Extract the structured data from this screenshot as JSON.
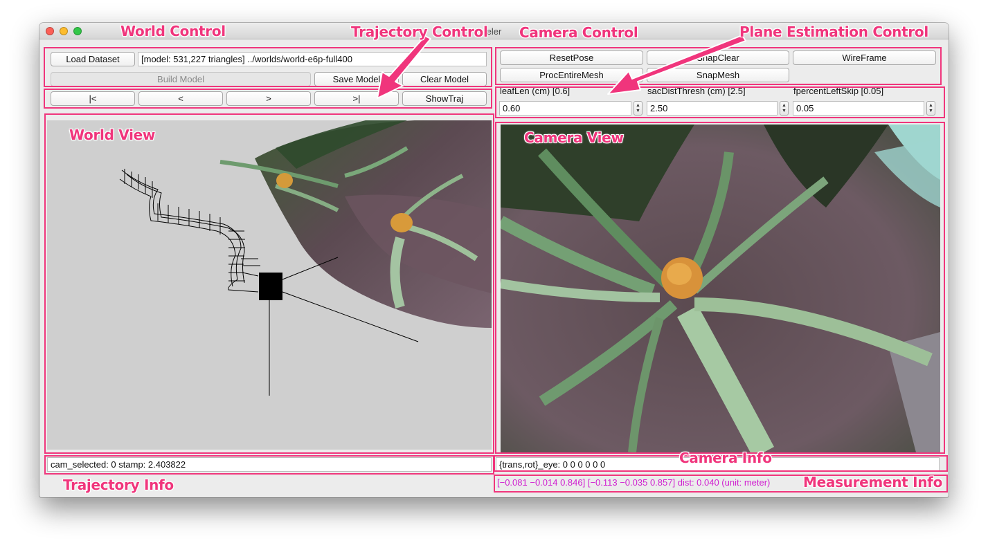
{
  "window": {
    "title": "eler"
  },
  "world_control": {
    "load_label": "Load Dataset",
    "dataset_path": "[model: 531,227 triangles] ../worlds/world-e6p-full400",
    "build_label": "Build Model",
    "save_label": "Save Model",
    "clear_label": "Clear Model"
  },
  "trajectory_control": {
    "first_label": "|<",
    "prev_label": "<",
    "next_label": ">",
    "last_label": ">|",
    "showtraj_label": "ShowTraj"
  },
  "camera_control": {
    "resetpose_label": "ResetPose",
    "snapclear_label": "SnapClear",
    "wireframe_label": "WireFrame",
    "procentire_label": "ProcEntireMesh",
    "snapmesh_label": "SnapMesh"
  },
  "plane_control": {
    "leaflen_label": "leafLen (cm) [0.6]",
    "leaflen_value": "0.60",
    "sacdist_label": "sacDistThresh (cm) [2.5]",
    "sacdist_value": "2.50",
    "fpercent_label": "fpercentLeftSkip [0.05]",
    "fpercent_value": "0.05"
  },
  "trajectory_info": {
    "text": "cam_selected: 0 stamp: 2.403822"
  },
  "camera_info": {
    "text": "{trans,rot}_eye: 0 0 0 0 0 0"
  },
  "measurement_info": {
    "text": "[−0.081 −0.014 0.846] [−0.113 −0.035 0.857] dist: 0.040 (unit: meter)"
  },
  "annotations": {
    "world_control": "World Control",
    "trajectory_control": "Trajectory Control",
    "camera_control": "Camera Control",
    "plane_estimation_control": "Plane Estimation Control",
    "world_view": "World View",
    "camera_view": "Camera View",
    "camera_info": "Camera Info",
    "trajectory_info": "Trajectory Info",
    "measurement_info": "Measurement Info"
  },
  "colors": {
    "annotation": "#f0357c",
    "measurement_text": "#d020d0",
    "world_bg": "#cfcfcf",
    "sky": "#9fd6cf"
  },
  "icons": [
    "stepper-icon",
    "traffic-light-icons"
  ]
}
